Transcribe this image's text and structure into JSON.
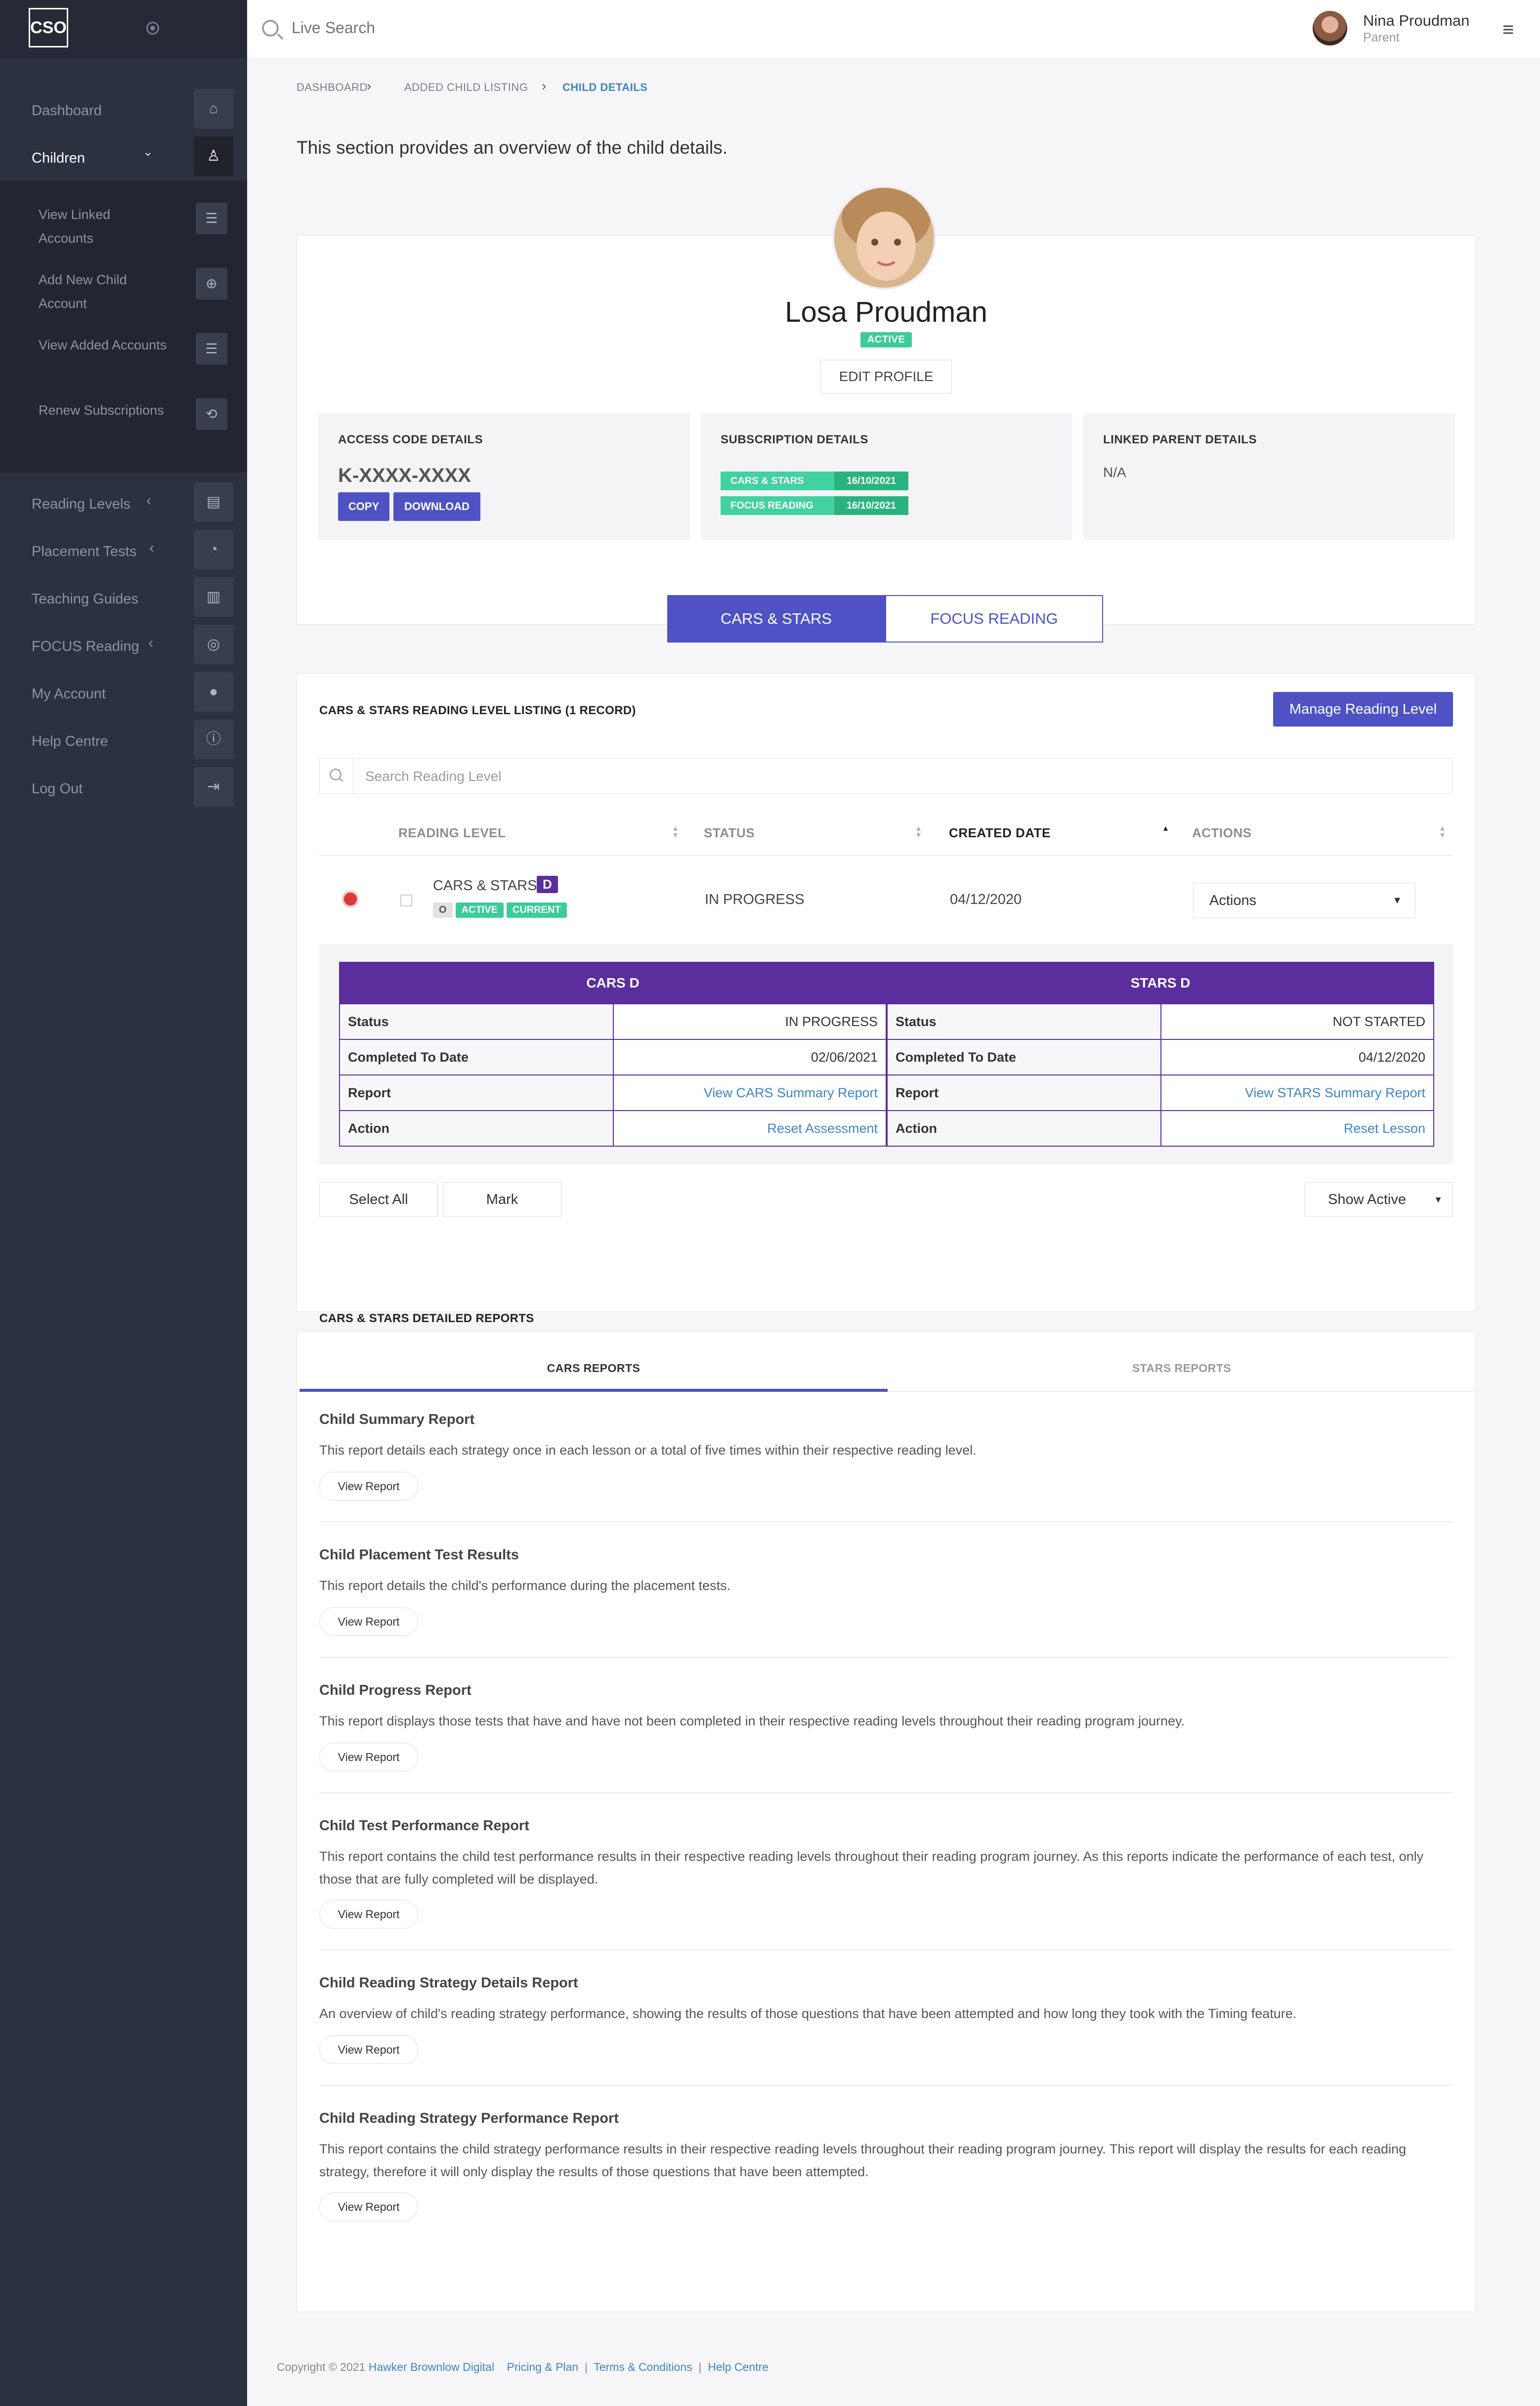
{
  "app": {
    "logo_text": "CSO",
    "search_placeholder": "Live Search"
  },
  "user": {
    "name": "Nina Proudman",
    "role": "Parent"
  },
  "sidebar": {
    "items": [
      {
        "label": "Dashboard",
        "icon": "home-icon"
      },
      {
        "label": "Children",
        "icon": "child-icon"
      },
      {
        "label": "Reading Levels",
        "icon": "book-icon"
      },
      {
        "label": "Placement Tests",
        "icon": "gauge-icon"
      },
      {
        "label": "Teaching Guides",
        "icon": "library-icon"
      },
      {
        "label": "FOCUS Reading",
        "icon": "target-icon"
      },
      {
        "label": "My Account",
        "icon": "user-icon"
      },
      {
        "label": "Help Centre",
        "icon": "info-icon"
      },
      {
        "label": "Log Out",
        "icon": "logout-icon"
      }
    ],
    "children_sub": [
      {
        "label": "View Linked Accounts",
        "icon": "list-icon"
      },
      {
        "label": "Add New Child Account",
        "icon": "plus-circle-icon"
      },
      {
        "label": "View Added Accounts",
        "icon": "list-icon"
      },
      {
        "label": "Renew Subscriptions",
        "icon": "renew-icon"
      }
    ]
  },
  "breadcrumb": [
    "DASHBOARD",
    "ADDED CHILD LISTING",
    "CHILD DETAILS"
  ],
  "intro": "This section provides an overview of the child details.",
  "profile": {
    "name": "Losa Proudman",
    "status": "ACTIVE",
    "edit_label": "EDIT PROFILE",
    "access": {
      "title": "ACCESS CODE DETAILS",
      "code": "K-XXXX-XXXX",
      "copy": "COPY",
      "download": "DOWNLOAD"
    },
    "subscription": {
      "title": "SUBSCRIPTION DETAILS",
      "items": [
        {
          "name": "CARS & STARS",
          "date": "16/10/2021"
        },
        {
          "name": "FOCUS READING",
          "date": "16/10/2021"
        }
      ]
    },
    "linked": {
      "title": "LINKED PARENT DETAILS",
      "value": "N/A"
    }
  },
  "program_tabs": [
    "CARS & STARS",
    "FOCUS READING"
  ],
  "listing": {
    "title": "CARS & STARS READING LEVEL LISTING (1 RECORD)",
    "manage": "Manage Reading Level",
    "search_placeholder": "Search Reading Level",
    "columns": [
      "READING LEVEL",
      "STATUS",
      "CREATED DATE",
      "ACTIONS"
    ],
    "row": {
      "level": "CARS & STARS",
      "level_badge": "D",
      "tags": [
        "O",
        "ACTIVE",
        "CURRENT"
      ],
      "status": "IN PROGRESS",
      "created": "04/12/2020",
      "actions": "Actions"
    },
    "cars": {
      "header": "CARS D",
      "rows": [
        [
          "Status",
          "IN PROGRESS"
        ],
        [
          "Completed To Date",
          "02/06/2021"
        ],
        [
          "Report",
          "View CARS Summary Report"
        ],
        [
          "Action",
          "Reset Assessment"
        ]
      ]
    },
    "stars": {
      "header": "STARS D",
      "rows": [
        [
          "Status",
          "NOT STARTED"
        ],
        [
          "Completed To Date",
          "04/12/2020"
        ],
        [
          "Report",
          "View STARS Summary Report"
        ],
        [
          "Action",
          "Reset Lesson"
        ]
      ]
    },
    "select_all": "Select All",
    "mark": "Mark",
    "show_active": "Show Active"
  },
  "reports": {
    "title": "CARS & STARS DETAILED REPORTS",
    "tabs": [
      "CARS REPORTS",
      "STARS REPORTS"
    ],
    "view_label": "View Report",
    "items": [
      {
        "title": "Child Summary Report",
        "desc": "This report details each strategy once in each lesson or a total of five times within their respective reading level."
      },
      {
        "title": "Child Placement Test Results",
        "desc": "This report details the child's performance during the placement tests."
      },
      {
        "title": "Child Progress Report",
        "desc": "This report displays those tests that have and have not been completed in their respective reading levels throughout their reading program journey."
      },
      {
        "title": "Child Test Performance Report",
        "desc": "This report contains the child test performance results in their respective reading levels throughout their reading program journey. As this reports indicate the performance of each test, only those that are fully completed will be displayed."
      },
      {
        "title": "Child Reading Strategy Details Report",
        "desc": "An overview of child's reading strategy performance, showing the results of those questions that have been attempted and how long they took with the Timing feature."
      },
      {
        "title": "Child Reading Strategy Performance Report",
        "desc": "This report contains the child strategy performance results in their respective reading levels throughout their reading program journey. This report will display the results for each reading strategy, therefore it will only display the results of those questions that have been attempted."
      }
    ]
  },
  "footer": {
    "copyright": "Copyright © 2021",
    "company": "Hawker Brownlow Digital",
    "links": [
      "Pricing & Plan",
      "Terms & Conditions",
      "Help Centre"
    ]
  },
  "colors": {
    "primary": "#4e52c4",
    "sidebar": "#2c3140",
    "success": "#3ccc9c",
    "table_header": "#5a2e9c",
    "link": "#3d86c6"
  }
}
